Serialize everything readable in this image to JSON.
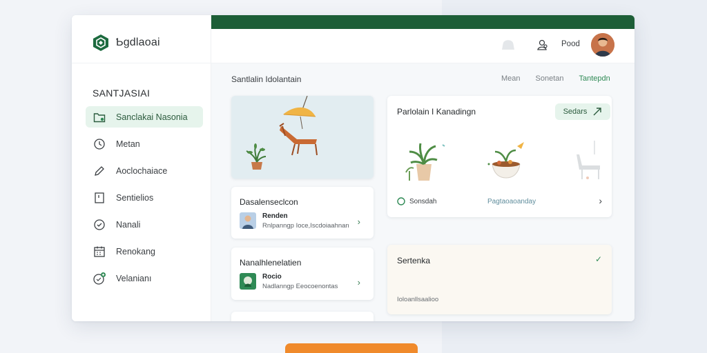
{
  "brand": {
    "name": "Ƅgdlaoai"
  },
  "sidebar": {
    "section_title": "SANTJASIAI",
    "items": [
      {
        "label": "Sanclakai Nasonia",
        "icon": "folder-icon",
        "active": true
      },
      {
        "label": "Metan",
        "icon": "clock-icon",
        "active": false
      },
      {
        "label": "Aoclochaiace",
        "icon": "pencil-icon",
        "active": false
      },
      {
        "label": "Sentielios",
        "icon": "bookmark-icon",
        "active": false
      },
      {
        "label": "Nanali",
        "icon": "check-circle-icon",
        "active": false
      },
      {
        "label": "Renokang",
        "icon": "calendar-icon",
        "active": false
      },
      {
        "label": "Velanianı",
        "icon": "plus-circle-icon",
        "active": false
      }
    ]
  },
  "topbar": {
    "user_name": "Pood"
  },
  "main": {
    "page_title": "Santlalin Idolantain",
    "tabs": [
      {
        "label": "Mean",
        "active": false
      },
      {
        "label": "Sonetan",
        "active": false
      },
      {
        "label": "Tantepdn",
        "active": true
      }
    ]
  },
  "cards": {
    "list1": {
      "title": "Dasalenseclcon",
      "row_name": "Renden",
      "row_desc": "Rnlpanngp Ioce,Iscdoiaahnan"
    },
    "list2": {
      "title": "Nanalhlenelatien",
      "row_name": "Rocio",
      "row_desc": "Nadlanngp Eeocoenontas"
    },
    "planner": {
      "title": "Parlolain I Kanadingn",
      "button_label": "Sedars",
      "footer_left": "Sonsdah",
      "footer_mid": "Pagtaoaoanday"
    },
    "soft": {
      "title": "Sertenka",
      "note": "Ioloanllsaalioo"
    }
  },
  "colors": {
    "accent": "#1d5e37",
    "active_bg": "#e6f4ec",
    "link_green": "#2f8a55",
    "cta_orange": "#f08a2b"
  }
}
